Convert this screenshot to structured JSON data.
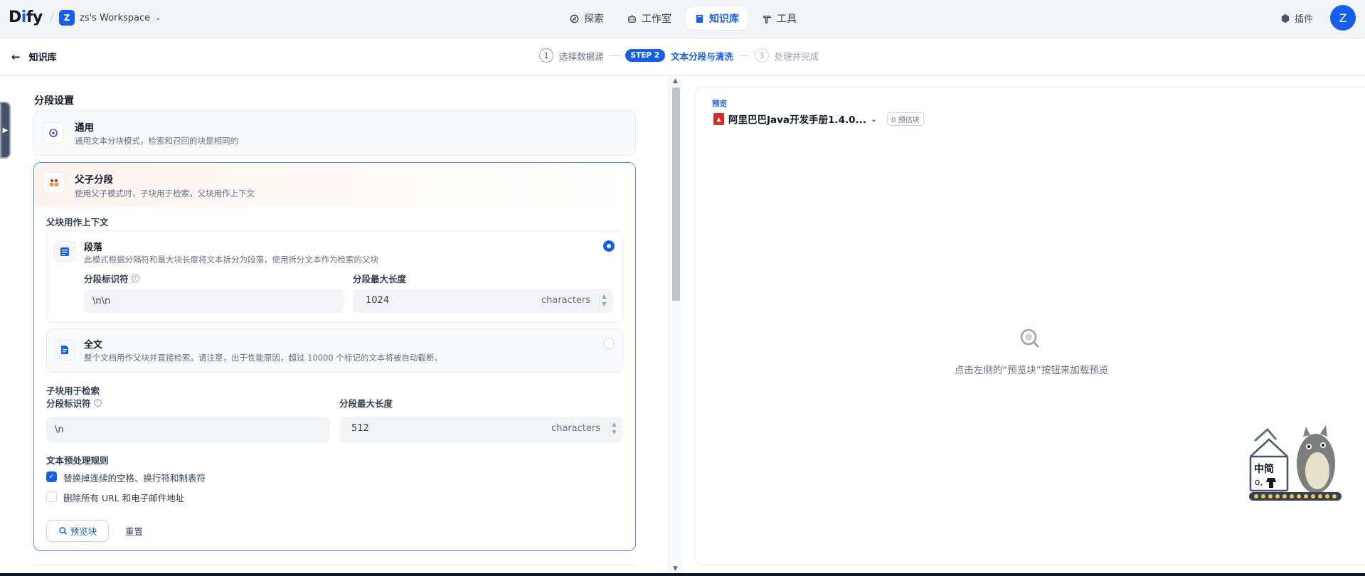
{
  "app": {
    "logo_prefix": "D",
    "logo_i": "i",
    "logo_suffix": "fy",
    "workspace_initial": "Z",
    "workspace_name": "zs's Workspace"
  },
  "nav": {
    "items": [
      {
        "label": "探索",
        "icon": "compass-icon"
      },
      {
        "label": "工作室",
        "icon": "robot-icon"
      },
      {
        "label": "知识库",
        "icon": "book-icon",
        "active": true
      },
      {
        "label": "工具",
        "icon": "hammer-icon"
      }
    ],
    "plugins_label": "插件",
    "avatar_initial": "Z"
  },
  "subheader": {
    "back_label": "知识库",
    "steps": [
      {
        "num": "1",
        "label": "选择数据源"
      },
      {
        "badge": "STEP 2",
        "label": "文本分段与清洗"
      },
      {
        "num": "3",
        "label": "处理并完成"
      }
    ]
  },
  "settings": {
    "section_title": "分段设置",
    "general": {
      "title": "通用",
      "desc": "通用文本分块模式，检索和召回的块是相同的"
    },
    "parent_child": {
      "title": "父子分段",
      "desc": "使用父子模式时，子块用于检索，父块用作上下文",
      "parent_label": "父块用作上下文",
      "paragraph": {
        "title": "段落",
        "desc": "此模式根据分隔符和最大块长度将文本拆分为段落，使用拆分文本作为检索的父块",
        "separator_label": "分段标识符",
        "separator_value": "\\n\\n",
        "maxlen_label": "分段最大长度",
        "maxlen_value": "1024",
        "unit": "characters"
      },
      "fulltext": {
        "title": "全文",
        "desc": "整个文档用作父块并直接检索。请注意，出于性能原因，超过 10000 个标记的文本将被自动截断。"
      },
      "child_label": "子块用于检索",
      "child": {
        "separator_label": "分段标识符",
        "separator_value": "\\n",
        "maxlen_label": "分段最大长度",
        "maxlen_value": "512",
        "unit": "characters"
      },
      "rules_label": "文本预处理规则",
      "rule1": "替换掉连续的空格、换行符和制表符",
      "rule1_checked": true,
      "rule2": "删除所有 URL 和电子邮件地址",
      "rule2_checked": false,
      "preview_button": "预览块",
      "reset_button": "重置"
    }
  },
  "preview": {
    "label": "预览",
    "file_name": "阿里巴巴Java开发手册1.4.0...",
    "count_badge": "0 预估块",
    "empty_text": "点击左侧的“预览块”按钮来加载预览",
    "mascot_text": "中简"
  },
  "colors": {
    "accent": "#155eef",
    "pdf_red": "#d92d20",
    "page_bg": "#f2f4f7"
  }
}
